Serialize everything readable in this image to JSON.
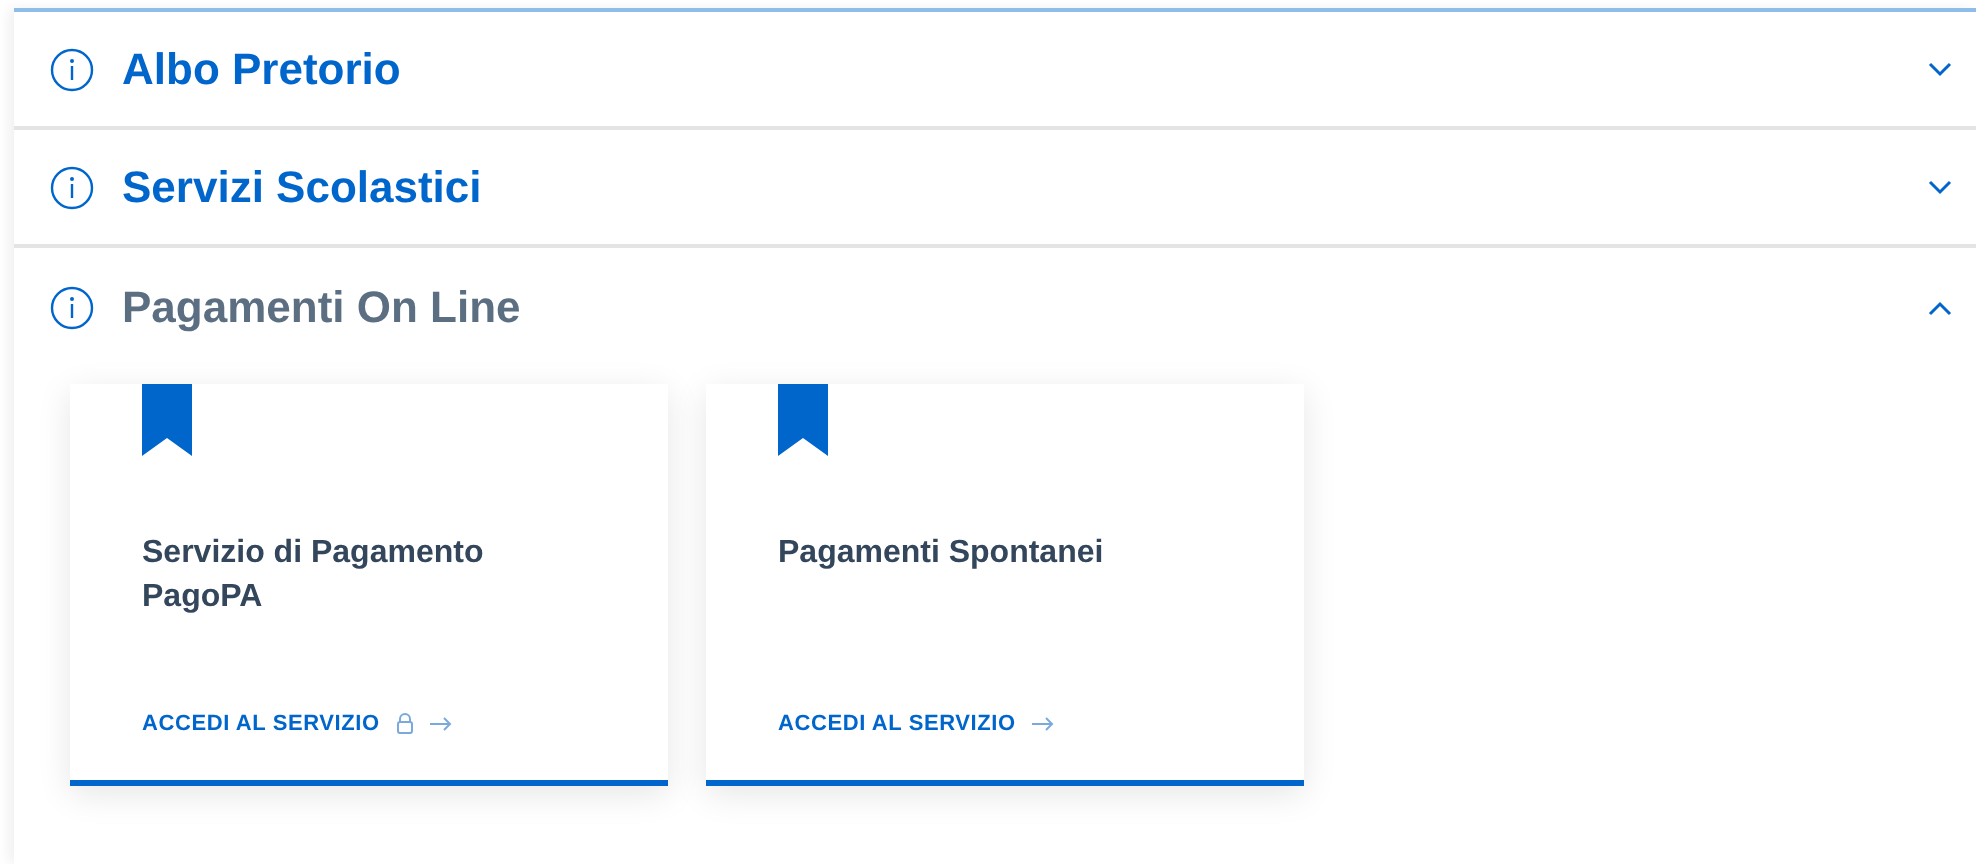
{
  "sections": [
    {
      "title": "Albo Pretorio",
      "expanded": false
    },
    {
      "title": "Servizi Scolastici",
      "expanded": false
    },
    {
      "title": "Pagamenti On Line",
      "expanded": true,
      "cards": [
        {
          "title": "Servizio di Pagamento PagoPA",
          "link": "ACCEDI AL SERVIZIO",
          "locked": true
        },
        {
          "title": "Pagamenti Spontanei",
          "link": "ACCEDI AL SERVIZIO",
          "locked": false
        }
      ]
    }
  ]
}
